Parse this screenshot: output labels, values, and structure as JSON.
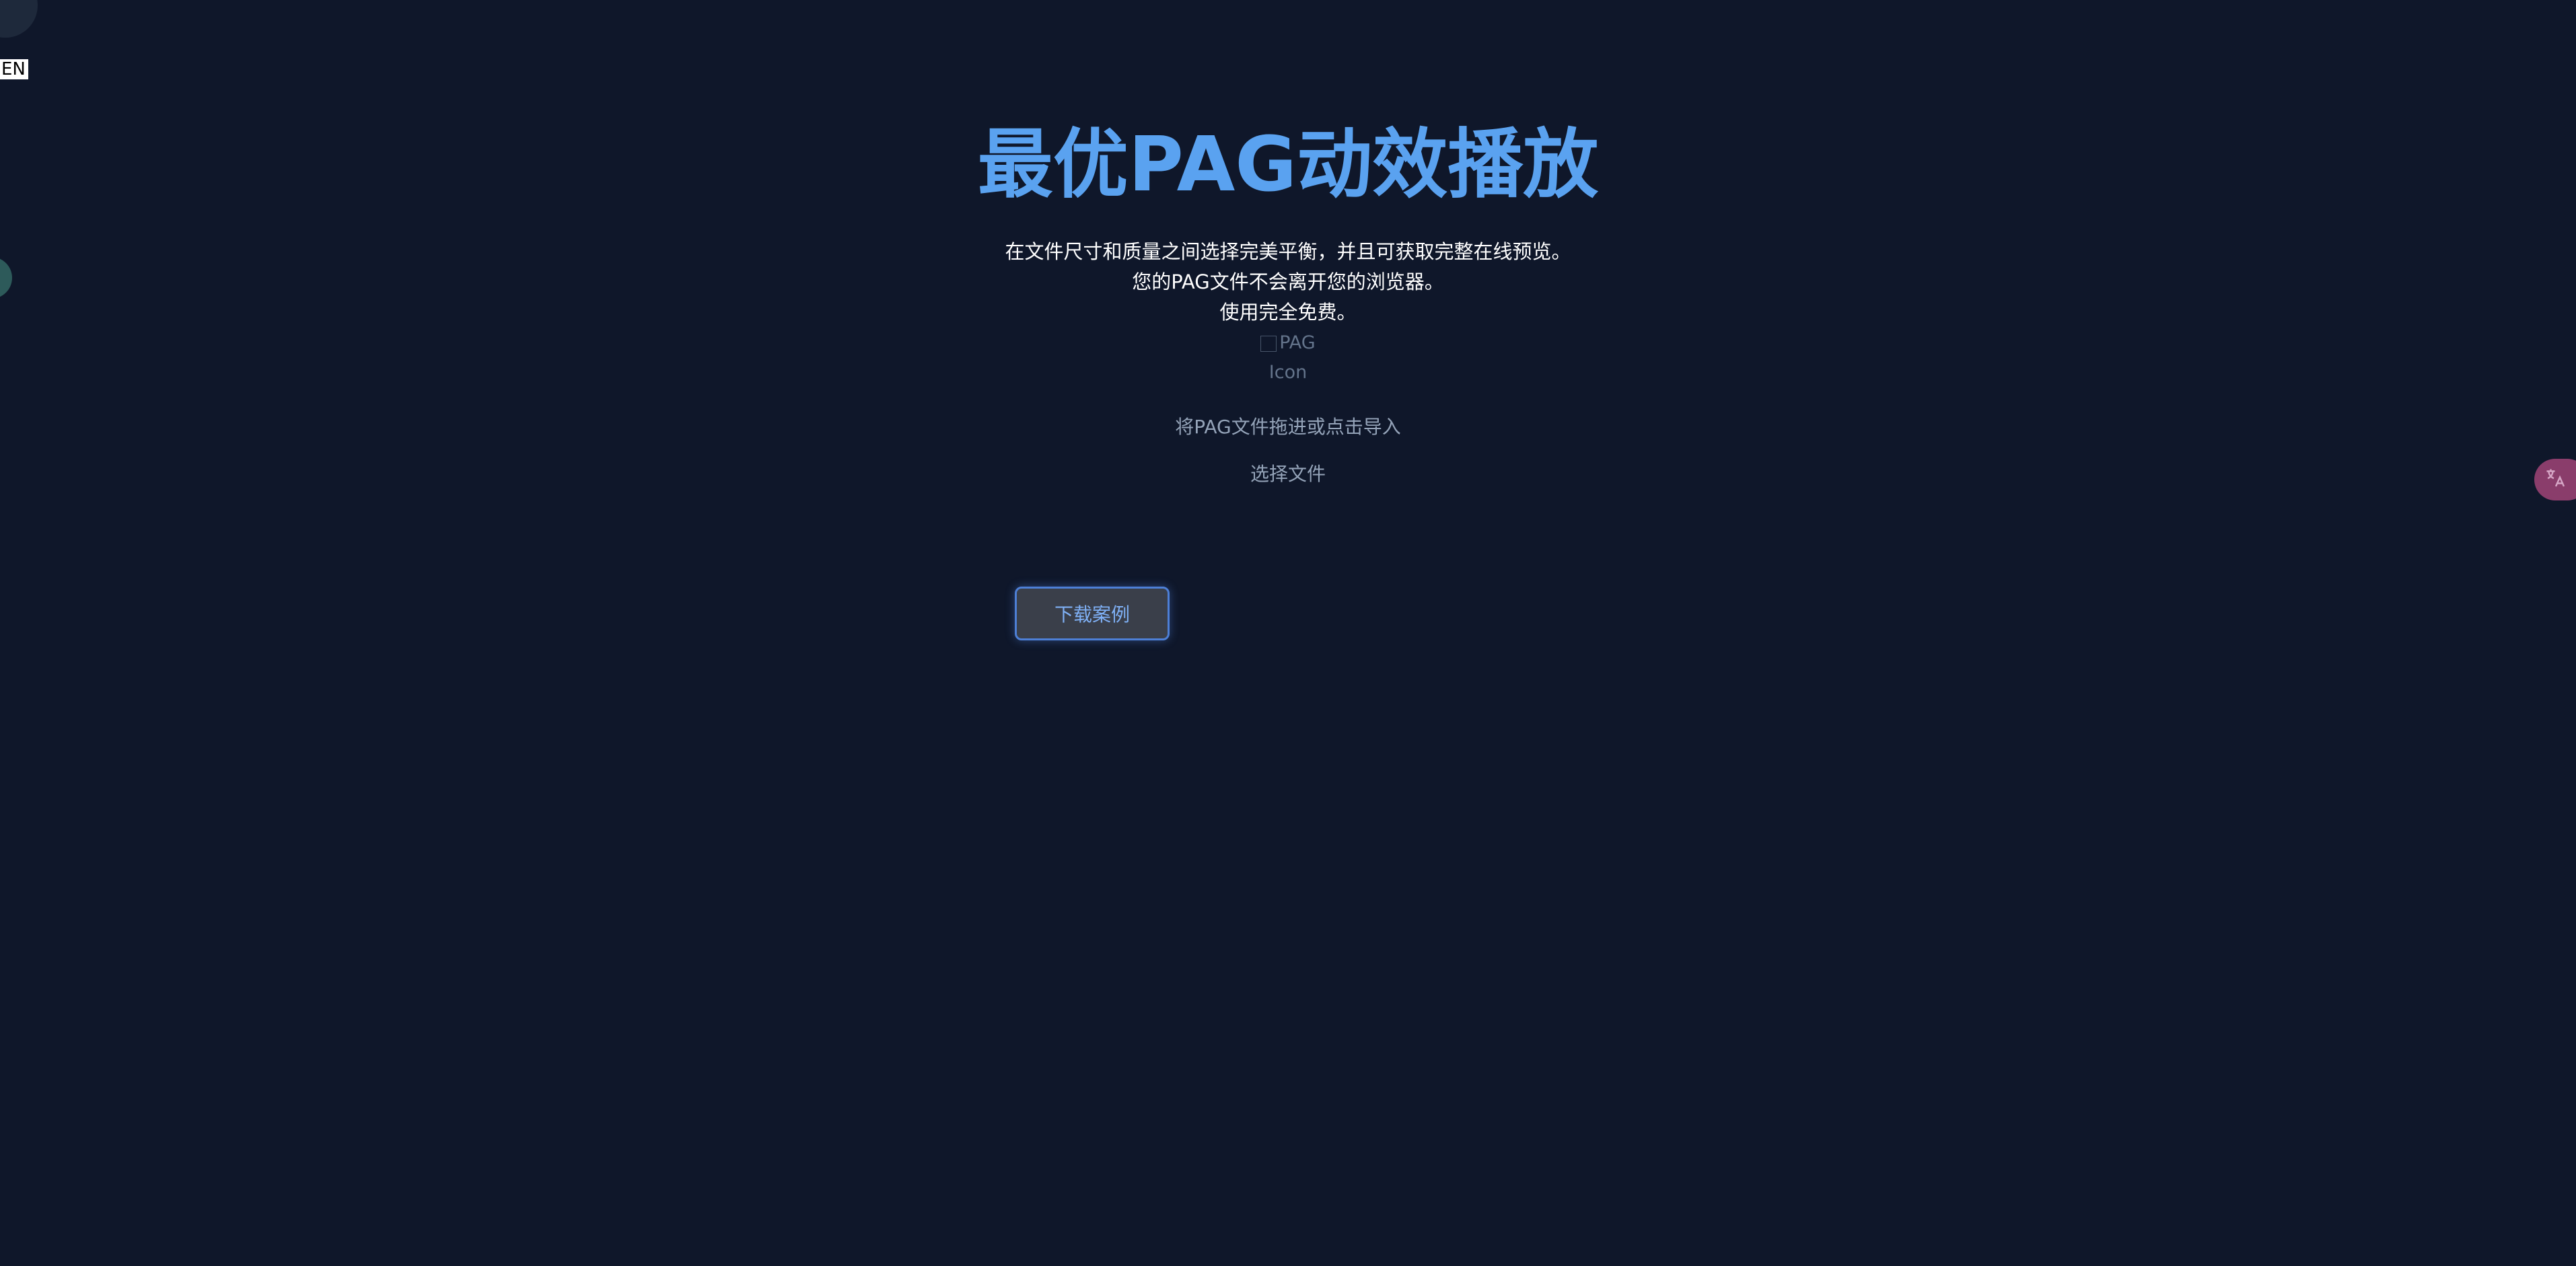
{
  "lang_toggle": "EN",
  "hero": {
    "title": "最优PAG动效播放",
    "description_lines": [
      "在文件尺寸和质量之间选择完美平衡，并且可获取完整在线预览。",
      "您的PAG文件不会离开您的浏览器。",
      "使用完全免费。"
    ],
    "broken_image_alt": [
      "PAG",
      "Icon"
    ]
  },
  "upload": {
    "drop_hint": "将PAG文件拖进或点击导入",
    "choose_file_label": "选择文件"
  },
  "actions": {
    "download_example_label": "下载案例"
  },
  "icons": {
    "translate": "translate-icon",
    "broken_image": "broken-image-icon"
  },
  "colors": {
    "background": "#0f172a",
    "title": "#5aa2f0",
    "accent_border": "#4d7fd6",
    "translate_fab": "#8a3d6b"
  }
}
